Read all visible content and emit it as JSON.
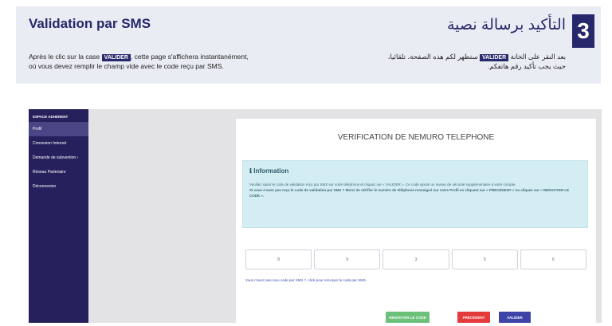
{
  "banner": {
    "title_fr": "Validation par SMS",
    "text_fr_1": "Après le clic sur la case",
    "tag_fr": "VALIDER",
    "text_fr_2": ", cette page s'affichera instantanément,",
    "text_fr_3": "où vous devez remplir le champ vide avec le code reçu par SMS.",
    "step_number": "3",
    "title_ar": "التأكيد برسالة نصية",
    "text_ar_1": "بعد النقر على الخانة",
    "tag_ar": "VALIDER",
    "text_ar_2": "ستظهر لكم هذه الصفحة، تلقائيا،",
    "text_ar_3": "حيث يجب تأكيد رقم هاتفكم."
  },
  "sidebar": {
    "header": "ESPACE ADHERENT",
    "items": [
      {
        "label": "Profil",
        "active": true
      },
      {
        "label": "Connexion Internet"
      },
      {
        "label": "Demande de subvention"
      },
      {
        "label": "Réseau Partenaire"
      },
      {
        "label": "Déconnexion"
      }
    ]
  },
  "page": {
    "title": "VERIFICATION DE NEMURO TELEPHONE",
    "info_title": "Information",
    "info_icon": "info-icon",
    "info_text_1": "Veuillez saisir le code de validation reçu par SMS sur votre téléphone et cliquez sur « VALIDER ». Ce code ajoute un niveau de sécurité supplémentaire à votre compte.",
    "info_text_2": "Si vous n'avez pas reçu le code de validation par SMS ? Merci de vérifier le numéro de téléphone renseigné sur votre Profil en cliquant sur « PRECEDENT » ou cliquez sur « RENVOYER LE CODE ».",
    "otp_digits": [
      "8",
      "9",
      "3",
      "5",
      "6"
    ],
    "resend_link": "Vous n'avez pas reçu code par SMS ?, click pour renvoyer le code par SMS",
    "buttons": {
      "resend": "RENVOYER LE CODE",
      "previous": "PRÉCÉDENT",
      "validate": "VALIDER"
    }
  },
  "colors": {
    "navy": "#27276b",
    "sidebar": "#26215d",
    "info_bg": "#d4edf3",
    "resend": "#6bc07a",
    "previous": "#e53a3a",
    "validate": "#3e43a7"
  }
}
